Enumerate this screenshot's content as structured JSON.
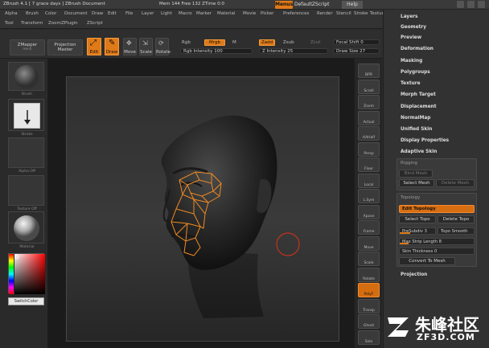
{
  "title_bar": {
    "app_info": "ZBrush 4.1 [ 7 grace days ]  ZBrush Document",
    "memory_info": "Mem 144 Free 132 ZTime 0:0",
    "menus_label": "Menus",
    "script_label": "DefaultZScript",
    "help_label": "Help"
  },
  "menus": {
    "row1": [
      "Alpha",
      "Brush",
      "Color",
      "Document",
      "Draw",
      "Edit",
      "File",
      "Layer",
      "Light",
      "Macro",
      "Marker",
      "Material",
      "Movie",
      "Picker",
      "Preferences",
      "Render",
      "Stencil",
      "Stroke",
      "Texture"
    ],
    "row2": [
      "Tool",
      "Transform",
      "Zoom",
      "ZPlugin",
      "ZScript"
    ]
  },
  "shelf": {
    "zmapper": "ZMapper",
    "zmapper_sub": "rev-E",
    "projection_master": "Projection Master",
    "edit": "Edit",
    "draw": "Draw",
    "move": "Move",
    "scale": "Scale",
    "rotate": "Rotate",
    "rgb_label": "Rgb",
    "mrgb_label": "Mrgb",
    "m_label": "M",
    "rgb_intensity": "Rgb Intensity 100",
    "zadd": "Zadd",
    "zsub": "Zsub",
    "zcut": "Zcut",
    "z_intensity": "Z Intensity 25",
    "focal_shift": "Focal Shift 0",
    "draw_size": "Draw Size 27"
  },
  "left_tray": {
    "slot_captions": [
      "Brush",
      "Stroke",
      "Alpha Off",
      "Texture Off",
      "Material"
    ],
    "switch_color": "SwitchColor"
  },
  "right_shelf": {
    "buttons": [
      "BPR",
      "Scroll",
      "Zoom",
      "Actual",
      "AAHalf",
      "Persp",
      "Floor",
      "Local",
      "L.Sym",
      "Xpose",
      "Frame",
      "Move",
      "Scale",
      "Rotate",
      "PolyF",
      "Transp",
      "Ghost",
      "Solo"
    ]
  },
  "panel": {
    "items_top": [
      "Layers",
      "Geometry",
      "Preview",
      "Deformation",
      "Masking",
      "Polygroups",
      "Texture",
      "Morph Target",
      "Displacement",
      "NormalMap",
      "Unified Skin",
      "Display Properties",
      "Adaptive Skin"
    ],
    "rigging": {
      "title": "Rigging",
      "select_mesh_dim": "Bind Mesh",
      "select_mesh": "Select Mesh",
      "delete_mesh": "Delete Mesh"
    },
    "topology": {
      "title": "Topology",
      "edit_topology": "Edit Topology",
      "select_topo": "Select Topo",
      "delete_topo": "Delete Topo",
      "presubdiv": "PreSubdiv 3",
      "topo_smooth": "Topo Smooth",
      "max_strip": "Max Strip Length 8",
      "skin_thickness": "Skin Thickness 0",
      "convert_to_mesh": "Convert To Mesh"
    },
    "projection": "Projection"
  },
  "colors": {
    "accent": "#e07a18",
    "topology_lines": "#f08a20",
    "background": "#1b1b1b"
  },
  "watermark": {
    "cn": "朱峰社区",
    "en": "ZF3D.COM"
  }
}
